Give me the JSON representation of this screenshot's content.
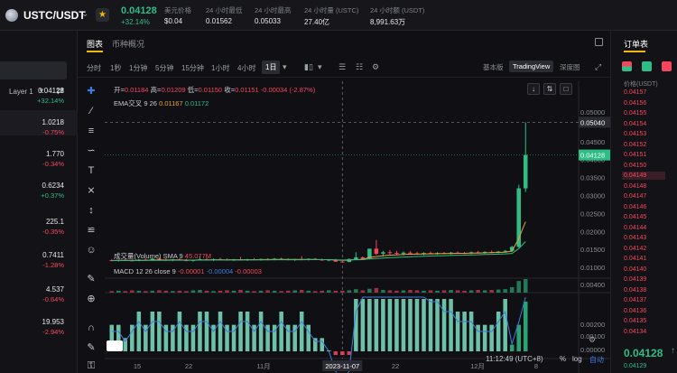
{
  "header": {
    "pair": "USTC/USDT",
    "last_price": "0.04128",
    "change_pct": "+32.14%",
    "stats": [
      {
        "label": "美元价格",
        "value": "$0.04"
      },
      {
        "label": "24 小时最低",
        "value": "0.01562"
      },
      {
        "label": "24 小时最高",
        "value": "0.05033"
      },
      {
        "label": "24 小时量 (USTC)",
        "value": "27.40亿"
      },
      {
        "label": "24 小时额 (USDT)",
        "value": "8,991.63万"
      }
    ]
  },
  "leftpanel": {
    "layer_label": "Layer 1",
    "rows": [
      {
        "price": "0.04128",
        "change": "+32.14%",
        "dir": "up"
      },
      {
        "price": "1.0218",
        "change": "-0.75%",
        "dir": "dn"
      },
      {
        "price": "1.770",
        "change": "-0.34%",
        "dir": "dn"
      },
      {
        "price": "0.6234",
        "change": "+0.37%",
        "dir": "up"
      },
      {
        "price": "225.1",
        "change": "-0.35%",
        "dir": "dn"
      },
      {
        "price": "0.7411",
        "change": "-1.28%",
        "dir": "dn"
      },
      {
        "price": "4.537",
        "change": "-0.64%",
        "dir": "dn"
      },
      {
        "price": "19.953",
        "change": "-2.94%",
        "dir": "dn"
      }
    ]
  },
  "chart_tabs": {
    "active": "图表",
    "other": "币种概况"
  },
  "toolbar": {
    "timeframes": [
      "分时",
      "1秒",
      "1分钟",
      "5分钟",
      "15分钟",
      "1小时",
      "4小时"
    ],
    "active_timeframe": "1日",
    "views": [
      "基本版",
      "TradingView",
      "深度图"
    ],
    "active_view": "TradingView"
  },
  "legends": {
    "ohlc": {
      "open_label": "开=",
      "open": "0.01184",
      "high_label": "高=",
      "high": "0.01209",
      "low_label": "低=",
      "low": "0.01150",
      "close_label": "收=",
      "close": "0.01151",
      "change": "-0.00034 (-2.87%)"
    },
    "ema": {
      "label": "EMA交叉",
      "params": "9 26",
      "v1": "0.01167",
      "v2": "0.01172"
    },
    "volume": {
      "label": "成交量(Volume)",
      "params": "SMA 9",
      "value": "45.077M"
    },
    "macd": {
      "label": "MACD",
      "params": "12 26 close 9",
      "v1": "-0.00001",
      "v2": "-0.00004",
      "v3": "-0.00003"
    }
  },
  "price_axis": {
    "crosshair": "0.05040",
    "current": "0.04128",
    "top": "0.05000",
    "ticks": [
      "0.04500",
      "0.04000",
      "0.03500",
      "0.03000",
      "0.02500",
      "0.02000",
      "0.01500",
      "0.01000"
    ],
    "vol_tick": "0.00400",
    "macd_ticks": [
      "0.00200",
      "0.00100",
      "0.00000"
    ]
  },
  "time_axis": {
    "labels": [
      "15",
      "22",
      "11月",
      "15",
      "22",
      "12月",
      "8"
    ],
    "crosshair": "2023-11-07"
  },
  "footer": {
    "clock": "11:12:49 (UTC+8)",
    "pct": "%",
    "log": "log",
    "auto": "自动"
  },
  "orderbook": {
    "title": "订单表",
    "price_header": "价格(USDT)",
    "asks": [
      "0.04157",
      "0.04156",
      "0.04155",
      "0.04154",
      "0.04153",
      "0.04152",
      "0.04151",
      "0.04150",
      "0.04149",
      "0.04148",
      "0.04147",
      "0.04146",
      "0.04145",
      "0.04144",
      "0.04143",
      "0.04142",
      "0.04141",
      "0.04140",
      "0.04139",
      "0.04138",
      "0.04137",
      "0.04136",
      "0.04135",
      "0.04134"
    ],
    "mid": "0.04128",
    "bid": "0.04129"
  },
  "colors": {
    "up": "#2ebd85",
    "down": "#f6465d",
    "accent": "#f0b90b",
    "ema_fast": "#e8a23a",
    "macd_line": "#3b7ddd"
  },
  "chart_data": {
    "type": "candlestick",
    "note_candles": [
      {
        "o": 0.012,
        "h": 0.0123,
        "l": 0.0117,
        "c": 0.0119
      },
      {
        "o": 0.0119,
        "h": 0.01215,
        "l": 0.0116,
        "c": 0.01205
      },
      {
        "o": 0.01205,
        "h": 0.0124,
        "l": 0.01185,
        "c": 0.01195
      },
      {
        "o": 0.01195,
        "h": 0.0122,
        "l": 0.01165,
        "c": 0.0118
      },
      {
        "o": 0.0118,
        "h": 0.0123,
        "l": 0.0117,
        "c": 0.01215
      },
      {
        "o": 0.01215,
        "h": 0.0125,
        "l": 0.0119,
        "c": 0.012
      },
      {
        "o": 0.012,
        "h": 0.0126,
        "l": 0.01185,
        "c": 0.0124
      },
      {
        "o": 0.0124,
        "h": 0.0128,
        "l": 0.012,
        "c": 0.01215
      },
      {
        "o": 0.01215,
        "h": 0.01245,
        "l": 0.0118,
        "c": 0.01195
      },
      {
        "o": 0.01195,
        "h": 0.0123,
        "l": 0.0117,
        "c": 0.0122
      },
      {
        "o": 0.0122,
        "h": 0.0125,
        "l": 0.0119,
        "c": 0.012
      },
      {
        "o": 0.012,
        "h": 0.01235,
        "l": 0.01175,
        "c": 0.01185
      },
      {
        "o": 0.01185,
        "h": 0.01215,
        "l": 0.0116,
        "c": 0.01205
      },
      {
        "o": 0.01205,
        "h": 0.0132,
        "l": 0.0119,
        "c": 0.01225
      },
      {
        "o": 0.01225,
        "h": 0.0126,
        "l": 0.012,
        "c": 0.0121
      },
      {
        "o": 0.0121,
        "h": 0.01245,
        "l": 0.0118,
        "c": 0.0123
      },
      {
        "o": 0.0123,
        "h": 0.01265,
        "l": 0.01205,
        "c": 0.01215
      },
      {
        "o": 0.01215,
        "h": 0.0125,
        "l": 0.0119,
        "c": 0.012
      },
      {
        "o": 0.012,
        "h": 0.01235,
        "l": 0.01175,
        "c": 0.0122
      },
      {
        "o": 0.0122,
        "h": 0.0129,
        "l": 0.012,
        "c": 0.01205
      },
      {
        "o": 0.01205,
        "h": 0.0124,
        "l": 0.0118,
        "c": 0.01225
      },
      {
        "o": 0.01225,
        "h": 0.0126,
        "l": 0.01205,
        "c": 0.0121
      },
      {
        "o": 0.0121,
        "h": 0.01245,
        "l": 0.01185,
        "c": 0.0123
      },
      {
        "o": 0.0123,
        "h": 0.01255,
        "l": 0.012,
        "c": 0.01215
      },
      {
        "o": 0.01215,
        "h": 0.0126,
        "l": 0.01195,
        "c": 0.0124
      },
      {
        "o": 0.0124,
        "h": 0.0127,
        "l": 0.0121,
        "c": 0.01225
      },
      {
        "o": 0.01225,
        "h": 0.0125,
        "l": 0.01195,
        "c": 0.01205
      },
      {
        "o": 0.01205,
        "h": 0.0124,
        "l": 0.0118,
        "c": 0.01225
      },
      {
        "o": 0.01225,
        "h": 0.0131,
        "l": 0.012,
        "c": 0.01215
      },
      {
        "o": 0.01215,
        "h": 0.0125,
        "l": 0.0119,
        "c": 0.01235
      },
      {
        "o": 0.01235,
        "h": 0.0126,
        "l": 0.01205,
        "c": 0.01215
      },
      {
        "o": 0.01215,
        "h": 0.01245,
        "l": 0.01185,
        "c": 0.01195
      },
      {
        "o": 0.01195,
        "h": 0.0123,
        "l": 0.0117,
        "c": 0.01215
      },
      {
        "o": 0.01215,
        "h": 0.0124,
        "l": 0.0115,
        "c": 0.0116
      },
      {
        "o": 0.0116,
        "h": 0.01209,
        "l": 0.0115,
        "c": 0.01151
      },
      {
        "o": 0.01151,
        "h": 0.0125,
        "l": 0.0114,
        "c": 0.0123
      },
      {
        "o": 0.0123,
        "h": 0.0142,
        "l": 0.012,
        "c": 0.0128
      },
      {
        "o": 0.0128,
        "h": 0.013,
        "l": 0.0121,
        "c": 0.0123
      },
      {
        "o": 0.0123,
        "h": 0.015,
        "l": 0.0122,
        "c": 0.0152
      },
      {
        "o": 0.0152,
        "h": 0.0176,
        "l": 0.0134,
        "c": 0.0138
      },
      {
        "o": 0.0138,
        "h": 0.0146,
        "l": 0.013,
        "c": 0.0142
      },
      {
        "o": 0.0142,
        "h": 0.0148,
        "l": 0.0136,
        "c": 0.014
      },
      {
        "o": 0.014,
        "h": 0.0146,
        "l": 0.0134,
        "c": 0.0138
      },
      {
        "o": 0.0138,
        "h": 0.0144,
        "l": 0.0133,
        "c": 0.0141
      },
      {
        "o": 0.0141,
        "h": 0.0145,
        "l": 0.0136,
        "c": 0.0139
      },
      {
        "o": 0.0139,
        "h": 0.0143,
        "l": 0.0135,
        "c": 0.0137
      },
      {
        "o": 0.0137,
        "h": 0.0142,
        "l": 0.0134,
        "c": 0.014
      },
      {
        "o": 0.014,
        "h": 0.0144,
        "l": 0.0137,
        "c": 0.0138
      },
      {
        "o": 0.0138,
        "h": 0.0142,
        "l": 0.0135,
        "c": 0.014
      },
      {
        "o": 0.014,
        "h": 0.0143,
        "l": 0.0137,
        "c": 0.0139
      },
      {
        "o": 0.0139,
        "h": 0.0143,
        "l": 0.0136,
        "c": 0.0141
      },
      {
        "o": 0.0141,
        "h": 0.0144,
        "l": 0.0138,
        "c": 0.014
      },
      {
        "o": 0.014,
        "h": 0.0143,
        "l": 0.0137,
        "c": 0.0139
      },
      {
        "o": 0.0139,
        "h": 0.0144,
        "l": 0.0137,
        "c": 0.0142
      },
      {
        "o": 0.0142,
        "h": 0.0146,
        "l": 0.0139,
        "c": 0.0141
      },
      {
        "o": 0.0141,
        "h": 0.0145,
        "l": 0.0138,
        "c": 0.0143
      },
      {
        "o": 0.0143,
        "h": 0.0147,
        "l": 0.014,
        "c": 0.0142
      },
      {
        "o": 0.0142,
        "h": 0.0146,
        "l": 0.0139,
        "c": 0.0144
      },
      {
        "o": 0.0144,
        "h": 0.0148,
        "l": 0.0141,
        "c": 0.0146
      },
      {
        "o": 0.0146,
        "h": 0.016,
        "l": 0.0143,
        "c": 0.0157
      },
      {
        "o": 0.0157,
        "h": 0.033,
        "l": 0.0155,
        "c": 0.032
      },
      {
        "o": 0.032,
        "h": 0.05033,
        "l": 0.031,
        "c": 0.04128
      }
    ],
    "volume": [
      4,
      5,
      4,
      6,
      5,
      4,
      5,
      6,
      5,
      4,
      5,
      4,
      6,
      7,
      5,
      4,
      5,
      6,
      5,
      7,
      5,
      4,
      5,
      6,
      5,
      4,
      5,
      6,
      7,
      5,
      4,
      5,
      6,
      5,
      5,
      6,
      9,
      6,
      10,
      12,
      7,
      6,
      5,
      6,
      7,
      6,
      5,
      6,
      5,
      6,
      7,
      6,
      5,
      6,
      7,
      6,
      7,
      8,
      9,
      14,
      30,
      35
    ],
    "macd_hist": [
      2e-05,
      2e-05,
      1e-05,
      2e-05,
      3e-05,
      2e-05,
      3e-05,
      3e-05,
      2e-05,
      2e-05,
      3e-05,
      2e-05,
      2e-05,
      3e-05,
      3e-05,
      2e-05,
      3e-05,
      2e-05,
      2e-05,
      3e-05,
      3e-05,
      2e-05,
      3e-05,
      2e-05,
      2e-05,
      3e-05,
      2e-05,
      2e-05,
      3e-05,
      2e-05,
      1e-05,
      1e-05,
      0.0,
      -2e-05,
      -3e-05,
      -2e-05,
      4e-05,
      6e-05,
      0.0001,
      0.00016,
      0.00014,
      0.00012,
      0.0001,
      9e-05,
      8e-05,
      7e-05,
      6e-05,
      5e-05,
      5e-05,
      4e-05,
      4e-05,
      3e-05,
      3e-05,
      3e-05,
      2e-05,
      2e-05,
      2e-05,
      3e-05,
      4e-05,
      0.0002,
      0.0008,
      0.0015
    ],
    "ylim": [
      0.009,
      0.053
    ]
  }
}
